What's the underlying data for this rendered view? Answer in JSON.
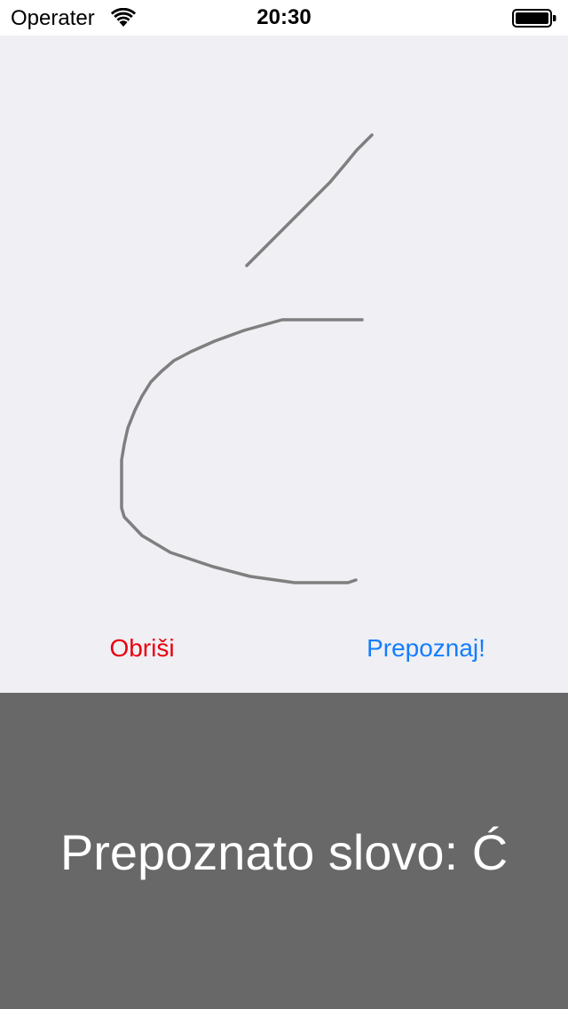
{
  "status_bar": {
    "carrier": "Operater",
    "time": "20:30",
    "wifi_icon": "wifi-icon",
    "battery_icon": "battery-full-icon"
  },
  "canvas": {
    "background": "#efeff4",
    "stroke_color": "#7f7f7f"
  },
  "actions": {
    "clear_label": "Obriši",
    "clear_color": "#e8000f",
    "recognize_label": "Prepoznaj!",
    "recognize_color": "#147efb"
  },
  "result": {
    "text": "Prepoznato slovo: Ć",
    "background": "#686868"
  }
}
